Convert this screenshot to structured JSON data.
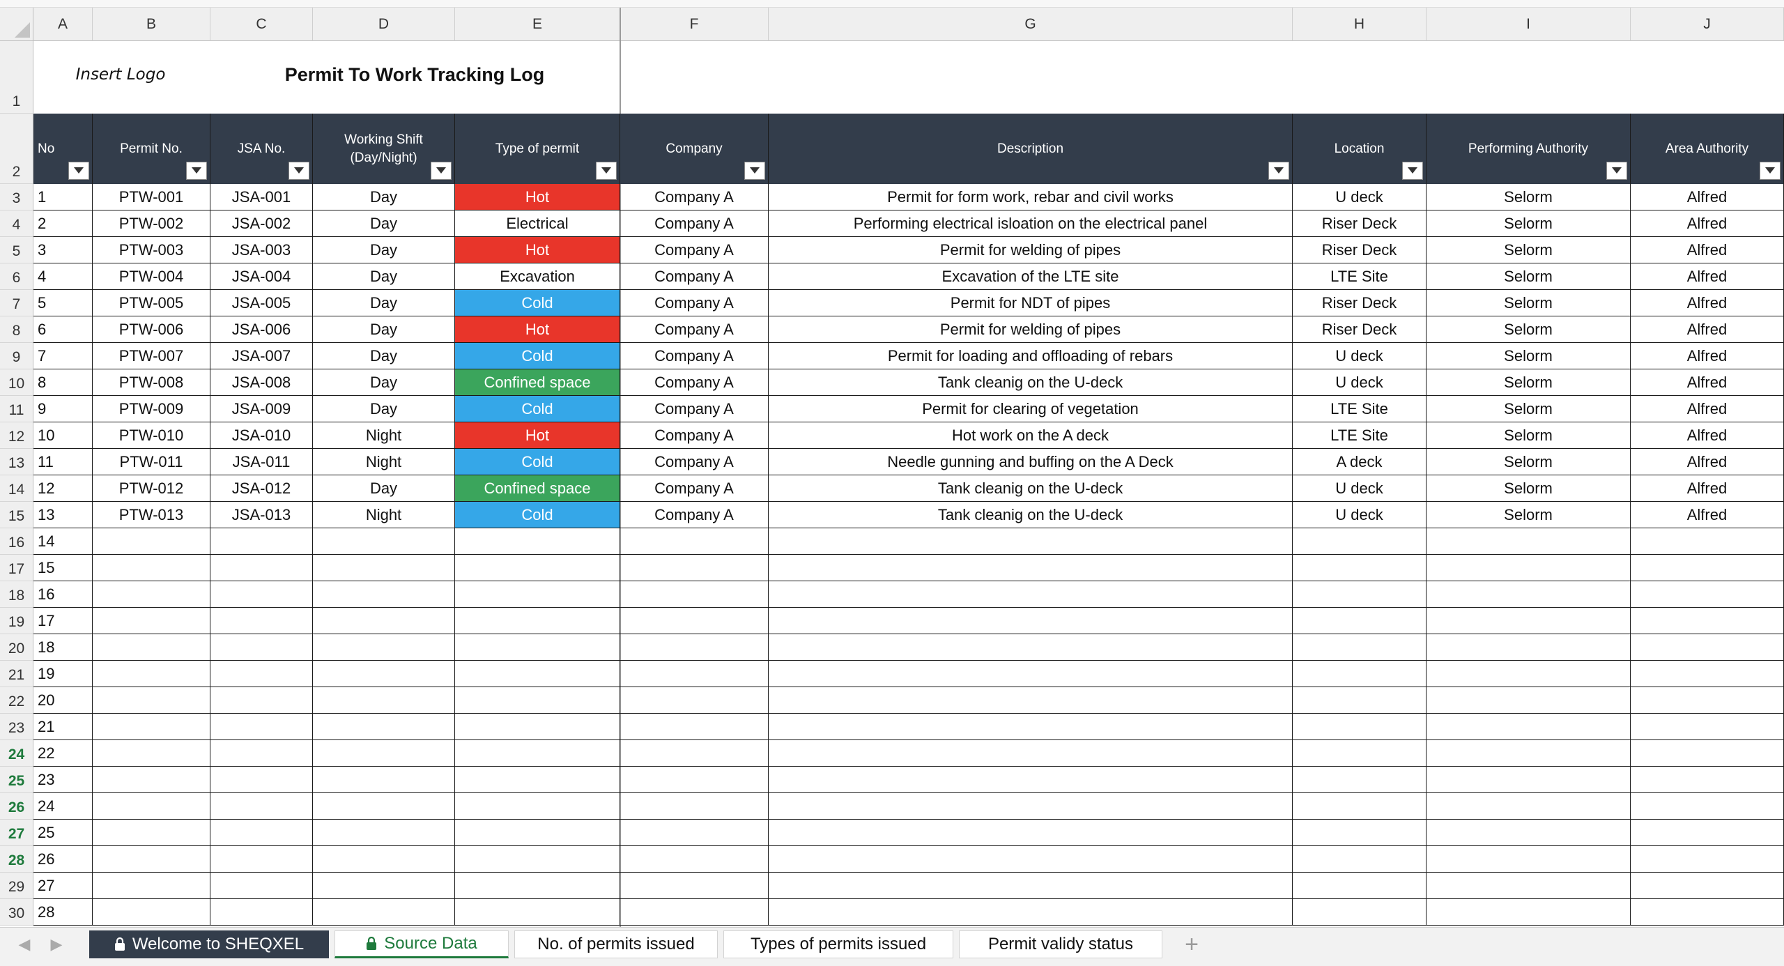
{
  "columns": [
    {
      "letter": "A"
    },
    {
      "letter": "B"
    },
    {
      "letter": "C"
    },
    {
      "letter": "D"
    },
    {
      "letter": "E"
    },
    {
      "letter": "F"
    },
    {
      "letter": "G"
    },
    {
      "letter": "H"
    },
    {
      "letter": "I"
    },
    {
      "letter": "J"
    }
  ],
  "title": {
    "logo": "Insert Logo",
    "main": "Permit To Work Tracking Log"
  },
  "headers": [
    "No",
    "Permit No.",
    "JSA No.",
    "Working Shift (Day/Night)",
    "Type of permit",
    "Company",
    "Description",
    "Location",
    "Performing Authority",
    "Area Authority"
  ],
  "row_numbers": [
    "1",
    "2",
    "3",
    "4",
    "5",
    "6",
    "7",
    "8",
    "9",
    "10",
    "11",
    "12",
    "13",
    "14",
    "15",
    "16",
    "17",
    "18",
    "19",
    "20",
    "21",
    "22",
    "23",
    "24",
    "25",
    "26",
    "27",
    "28",
    "29",
    "30"
  ],
  "colors": {
    "header_bg": "#333d4b",
    "hot": "#e8352a",
    "cold": "#35a7e8",
    "confined": "#3ba55c",
    "tab_active": "#1e7a3c"
  },
  "rows": [
    {
      "no": "1",
      "permit": "PTW-001",
      "jsa": "JSA-001",
      "shift": "Day",
      "type": "Hot",
      "company": "Company A",
      "desc": "Permit for form work, rebar and civil works",
      "location": "U deck",
      "performing": "Selorm",
      "area": "Alfred"
    },
    {
      "no": "2",
      "permit": "PTW-002",
      "jsa": "JSA-002",
      "shift": "Day",
      "type": "Electrical",
      "company": "Company A",
      "desc": "Performing electrical isloation on the electrical panel",
      "location": "Riser Deck",
      "performing": "Selorm",
      "area": "Alfred"
    },
    {
      "no": "3",
      "permit": "PTW-003",
      "jsa": "JSA-003",
      "shift": "Day",
      "type": "Hot",
      "company": "Company A",
      "desc": "Permit for welding of pipes",
      "location": "Riser Deck",
      "performing": "Selorm",
      "area": "Alfred"
    },
    {
      "no": "4",
      "permit": "PTW-004",
      "jsa": "JSA-004",
      "shift": "Day",
      "type": "Excavation",
      "company": "Company A",
      "desc": "Excavation of the LTE site",
      "location": "LTE Site",
      "performing": "Selorm",
      "area": "Alfred"
    },
    {
      "no": "5",
      "permit": "PTW-005",
      "jsa": "JSA-005",
      "shift": "Day",
      "type": "Cold",
      "company": "Company A",
      "desc": "Permit for NDT of pipes",
      "location": "Riser Deck",
      "performing": "Selorm",
      "area": "Alfred"
    },
    {
      "no": "6",
      "permit": "PTW-006",
      "jsa": "JSA-006",
      "shift": "Day",
      "type": "Hot",
      "company": "Company A",
      "desc": "Permit for welding of pipes",
      "location": "Riser Deck",
      "performing": "Selorm",
      "area": "Alfred"
    },
    {
      "no": "7",
      "permit": "PTW-007",
      "jsa": "JSA-007",
      "shift": "Day",
      "type": "Cold",
      "company": "Company A",
      "desc": "Permit for loading and offloading of rebars",
      "location": "U deck",
      "performing": "Selorm",
      "area": "Alfred"
    },
    {
      "no": "8",
      "permit": "PTW-008",
      "jsa": "JSA-008",
      "shift": "Day",
      "type": "Confined space",
      "company": "Company A",
      "desc": "Tank cleanig on the U-deck",
      "location": "U deck",
      "performing": "Selorm",
      "area": "Alfred"
    },
    {
      "no": "9",
      "permit": "PTW-009",
      "jsa": "JSA-009",
      "shift": "Day",
      "type": "Cold",
      "company": "Company A",
      "desc": "Permit for clearing of vegetation",
      "location": "LTE Site",
      "performing": "Selorm",
      "area": "Alfred"
    },
    {
      "no": "10",
      "permit": "PTW-010",
      "jsa": "JSA-010",
      "shift": "Night",
      "type": "Hot",
      "company": "Company A",
      "desc": "Hot work on the A deck",
      "location": "LTE Site",
      "performing": "Selorm",
      "area": "Alfred"
    },
    {
      "no": "11",
      "permit": "PTW-011",
      "jsa": "JSA-011",
      "shift": "Night",
      "type": "Cold",
      "company": "Company A",
      "desc": "Needle gunning and buffing on the A Deck",
      "location": "A deck",
      "performing": "Selorm",
      "area": "Alfred"
    },
    {
      "no": "12",
      "permit": "PTW-012",
      "jsa": "JSA-012",
      "shift": "Day",
      "type": "Confined space",
      "company": "Company A",
      "desc": "Tank cleanig on the U-deck",
      "location": "U deck",
      "performing": "Selorm",
      "area": "Alfred"
    },
    {
      "no": "13",
      "permit": "PTW-013",
      "jsa": "JSA-013",
      "shift": "Night",
      "type": "Cold",
      "company": "Company A",
      "desc": "Tank cleanig on the U-deck",
      "location": "U deck",
      "performing": "Selorm",
      "area": "Alfred"
    },
    {
      "no": "14"
    },
    {
      "no": "15"
    },
    {
      "no": "16"
    },
    {
      "no": "17"
    },
    {
      "no": "18"
    },
    {
      "no": "19"
    },
    {
      "no": "20"
    },
    {
      "no": "21"
    },
    {
      "no": "22"
    },
    {
      "no": "23"
    },
    {
      "no": "24"
    },
    {
      "no": "25"
    },
    {
      "no": "26"
    },
    {
      "no": "27"
    },
    {
      "no": "28"
    }
  ],
  "green_rows": [
    "24",
    "25",
    "26",
    "27",
    "28"
  ],
  "tabs": [
    {
      "label": "Welcome to SHEQXEL",
      "locked": true,
      "style": "dark"
    },
    {
      "label": "Source Data",
      "locked": true,
      "style": "active"
    },
    {
      "label": "No. of permits issued",
      "locked": false,
      "style": "normal"
    },
    {
      "label": "Types of permits issued",
      "locked": false,
      "style": "normal"
    },
    {
      "label": "Permit validy status",
      "locked": false,
      "style": "normal"
    }
  ],
  "icons": {
    "lock": "lock-icon",
    "filter": "filter-dropdown-icon",
    "add": "add-sheet-icon",
    "prev": "prev-sheet-icon",
    "next": "next-sheet-icon"
  }
}
